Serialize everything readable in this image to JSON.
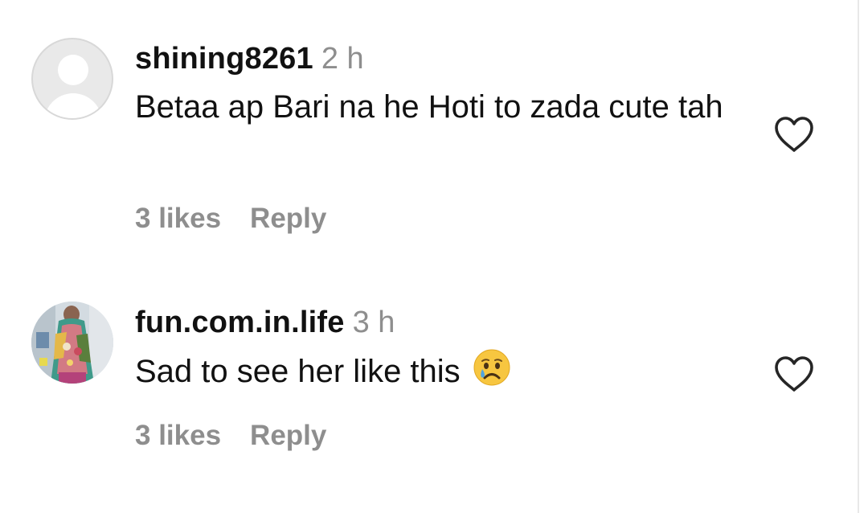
{
  "comments": [
    {
      "username": "shining8261",
      "time": "2 h",
      "text": "Betaa ap Bari na he Hoti to zada cute tah",
      "likes": "3 likes",
      "reply_label": "Reply",
      "avatar": "default-avatar-icon"
    },
    {
      "username": "fun.com.in.life",
      "time": "3 h",
      "text": "Sad to see her like this",
      "emoji": "crying-face-emoji",
      "likes": "3 likes",
      "reply_label": "Reply",
      "avatar": "profile-photo"
    }
  ],
  "colors": {
    "text": "#111111",
    "muted": "#8e8e8e",
    "avatar_bg": "#e9e9e9"
  }
}
